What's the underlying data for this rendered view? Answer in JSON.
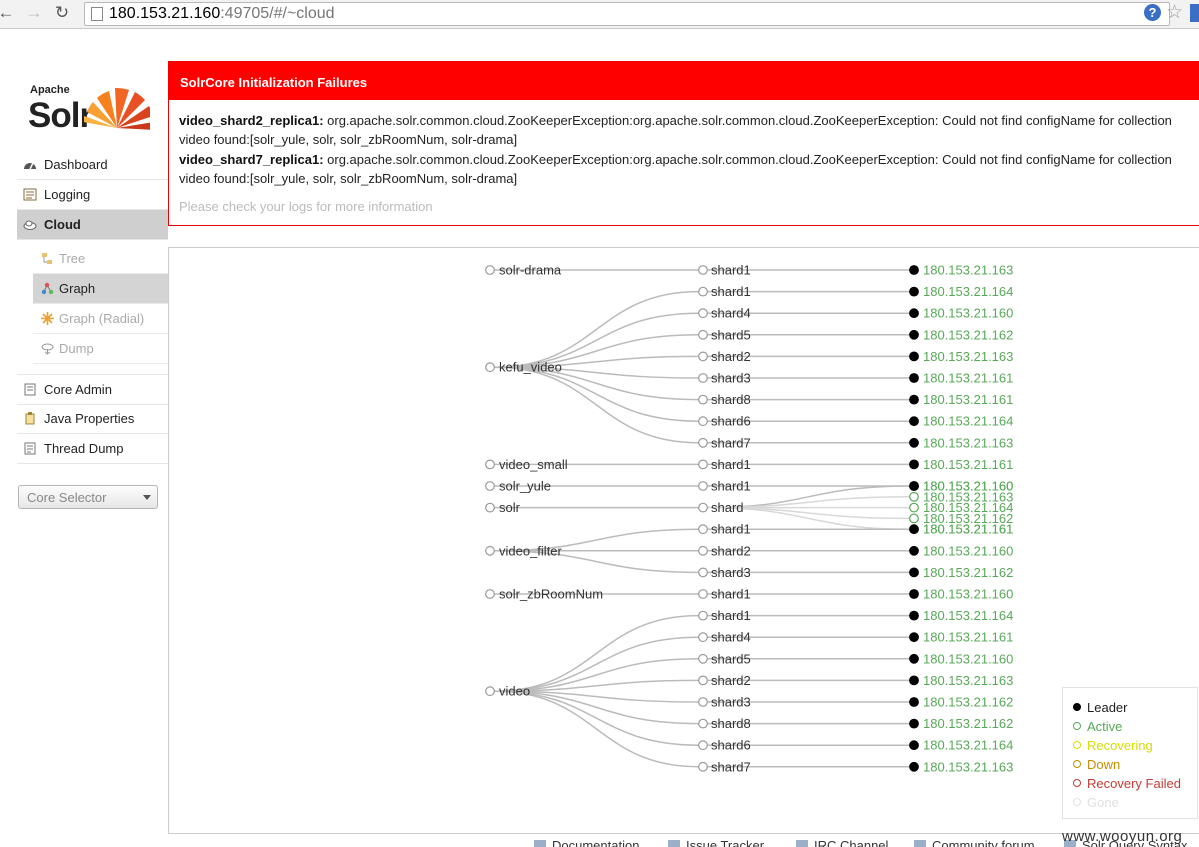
{
  "browser": {
    "url_host": "180.153.21.160",
    "url_rest": ":49705/#/~cloud"
  },
  "logo": {
    "small": "Apache",
    "big": "Solr"
  },
  "nav": {
    "items": [
      {
        "label": "Dashboard",
        "icon": "dashboard-icon"
      },
      {
        "label": "Logging",
        "icon": "logging-icon"
      },
      {
        "label": "Cloud",
        "icon": "cloud-icon"
      },
      {
        "label": "Core Admin",
        "icon": "core-admin-icon"
      },
      {
        "label": "Java Properties",
        "icon": "java-properties-icon"
      },
      {
        "label": "Thread Dump",
        "icon": "thread-dump-icon"
      }
    ],
    "cloud_sub": [
      {
        "label": "Tree",
        "icon": "tree-icon"
      },
      {
        "label": "Graph",
        "icon": "graph-icon"
      },
      {
        "label": "Graph (Radial)",
        "icon": "graph-radial-icon"
      },
      {
        "label": "Dump",
        "icon": "dump-icon"
      }
    ],
    "core_selector": "Core Selector"
  },
  "failures": {
    "title": "SolrCore Initialization Failures",
    "items": [
      {
        "core": "video_shard2_replica1:",
        "message": " org.apache.solr.common.cloud.ZooKeeperException:org.apache.solr.common.cloud.ZooKeeperException: Could not find configName for collection video found:[solr_yule, solr, solr_zbRoomNum, solr-drama]"
      },
      {
        "core": "video_shard7_replica1:",
        "message": " org.apache.solr.common.cloud.ZooKeeperException:org.apache.solr.common.cloud.ZooKeeperException: Could not find configName for collection video found:[solr_yule, solr, solr_zbRoomNum, solr-drama]"
      }
    ],
    "hint": "Please check your logs for more information"
  },
  "graph": {
    "collections": [
      {
        "name": "solr-drama",
        "shards": [
          {
            "name": "shard1",
            "replicas": [
              {
                "host": "180.153.21.163",
                "state": "leader"
              }
            ]
          }
        ]
      },
      {
        "name": "kefu_video",
        "shards": [
          {
            "name": "shard1",
            "replicas": [
              {
                "host": "180.153.21.164",
                "state": "leader"
              }
            ]
          },
          {
            "name": "shard4",
            "replicas": [
              {
                "host": "180.153.21.160",
                "state": "leader"
              }
            ]
          },
          {
            "name": "shard5",
            "replicas": [
              {
                "host": "180.153.21.162",
                "state": "leader"
              }
            ]
          },
          {
            "name": "shard2",
            "replicas": [
              {
                "host": "180.153.21.163",
                "state": "leader"
              }
            ]
          },
          {
            "name": "shard3",
            "replicas": [
              {
                "host": "180.153.21.161",
                "state": "leader"
              }
            ]
          },
          {
            "name": "shard8",
            "replicas": [
              {
                "host": "180.153.21.161",
                "state": "leader"
              }
            ]
          },
          {
            "name": "shard6",
            "replicas": [
              {
                "host": "180.153.21.164",
                "state": "leader"
              }
            ]
          },
          {
            "name": "shard7",
            "replicas": [
              {
                "host": "180.153.21.163",
                "state": "leader"
              }
            ]
          }
        ]
      },
      {
        "name": "video_small",
        "shards": [
          {
            "name": "shard1",
            "replicas": [
              {
                "host": "180.153.21.161",
                "state": "leader"
              }
            ]
          }
        ]
      },
      {
        "name": "solr_yule",
        "shards": [
          {
            "name": "shard1",
            "replicas": [
              {
                "host": "180.153.21.160",
                "state": "leader"
              }
            ]
          }
        ]
      },
      {
        "name": "solr",
        "shards": [
          {
            "name": "shard",
            "replicas": [
              {
                "host": "180.153.21.160",
                "state": "leader"
              },
              {
                "host": "180.153.21.163",
                "state": "active"
              },
              {
                "host": "180.153.21.164",
                "state": "active"
              },
              {
                "host": "180.153.21.162",
                "state": "active"
              },
              {
                "host": "180.153.21.161",
                "state": "active"
              }
            ]
          }
        ]
      },
      {
        "name": "video_filter",
        "shards": [
          {
            "name": "shard1",
            "replicas": [
              {
                "host": "180.153.21.161",
                "state": "leader"
              }
            ]
          },
          {
            "name": "shard2",
            "replicas": [
              {
                "host": "180.153.21.160",
                "state": "leader"
              }
            ]
          },
          {
            "name": "shard3",
            "replicas": [
              {
                "host": "180.153.21.162",
                "state": "leader"
              }
            ]
          }
        ]
      },
      {
        "name": "solr_zbRoomNum",
        "shards": [
          {
            "name": "shard1",
            "replicas": [
              {
                "host": "180.153.21.160",
                "state": "leader"
              }
            ]
          }
        ]
      },
      {
        "name": "video",
        "shards": [
          {
            "name": "shard1",
            "replicas": [
              {
                "host": "180.153.21.164",
                "state": "leader"
              }
            ]
          },
          {
            "name": "shard4",
            "replicas": [
              {
                "host": "180.153.21.161",
                "state": "leader"
              }
            ]
          },
          {
            "name": "shard5",
            "replicas": [
              {
                "host": "180.153.21.160",
                "state": "leader"
              }
            ]
          },
          {
            "name": "shard2",
            "replicas": [
              {
                "host": "180.153.21.163",
                "state": "leader"
              }
            ]
          },
          {
            "name": "shard3",
            "replicas": [
              {
                "host": "180.153.21.162",
                "state": "leader"
              }
            ]
          },
          {
            "name": "shard8",
            "replicas": [
              {
                "host": "180.153.21.162",
                "state": "leader"
              }
            ]
          },
          {
            "name": "shard6",
            "replicas": [
              {
                "host": "180.153.21.164",
                "state": "leader"
              }
            ]
          },
          {
            "name": "shard7",
            "replicas": [
              {
                "host": "180.153.21.163",
                "state": "leader"
              }
            ]
          }
        ]
      }
    ]
  },
  "legend": [
    {
      "label": "Leader",
      "color": "#000000",
      "filled": true
    },
    {
      "label": "Active",
      "color": "#57a957",
      "filled": false
    },
    {
      "label": "Recovering",
      "color": "#d5dd00",
      "filled": false
    },
    {
      "label": "Down",
      "color": "#c48f00",
      "filled": false
    },
    {
      "label": "Recovery Failed",
      "color": "#c43c35",
      "filled": false
    },
    {
      "label": "Gone",
      "color": "#e1e1e1",
      "filled": false
    }
  ],
  "footer": [
    {
      "label": "Documentation",
      "icon": "documentation-icon"
    },
    {
      "label": "Issue Tracker",
      "icon": "issue-tracker-icon"
    },
    {
      "label": "IRC Channel",
      "icon": "irc-channel-icon"
    },
    {
      "label": "Community forum",
      "icon": "community-forum-icon"
    },
    {
      "label": "Solr Query Syntax",
      "icon": "query-syntax-icon"
    }
  ],
  "watermark": "www.wooyun.org",
  "colors": {
    "leader": "#000000",
    "active": "#57a957",
    "host_text": "#57a957",
    "link": "#bbbbbb",
    "error": "#ff0000"
  }
}
